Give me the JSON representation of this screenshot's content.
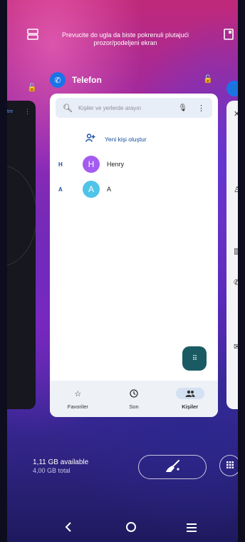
{
  "banner": {
    "text": "Prevucite do ugla da biste pokrenuli plutajući prozor/podeljeni ekran"
  },
  "left_app": {
    "label": "tre"
  },
  "app": {
    "name": "Telefon"
  },
  "search": {
    "placeholder": "Kişiler ve yerlerde arayın"
  },
  "create": {
    "label": "Yeni kişi oluştur"
  },
  "contacts": [
    {
      "section": "H",
      "initial": "H",
      "name": "Henry",
      "color": "#a45bf0"
    },
    {
      "section": "A",
      "initial": "A",
      "name": "A",
      "color": "#4fc3e8"
    }
  ],
  "tabs": [
    {
      "label": "Favoriler",
      "icon": "star-icon"
    },
    {
      "label": "Son",
      "icon": "clock-icon"
    },
    {
      "label": "Kişiler",
      "icon": "people-icon"
    }
  ],
  "memory": {
    "available": "1,11 GB available",
    "total": "4,00 GB total"
  },
  "colors": {
    "accent": "#1a73e8",
    "fab": "#1a5b63",
    "text_link": "#1a4fa0"
  }
}
